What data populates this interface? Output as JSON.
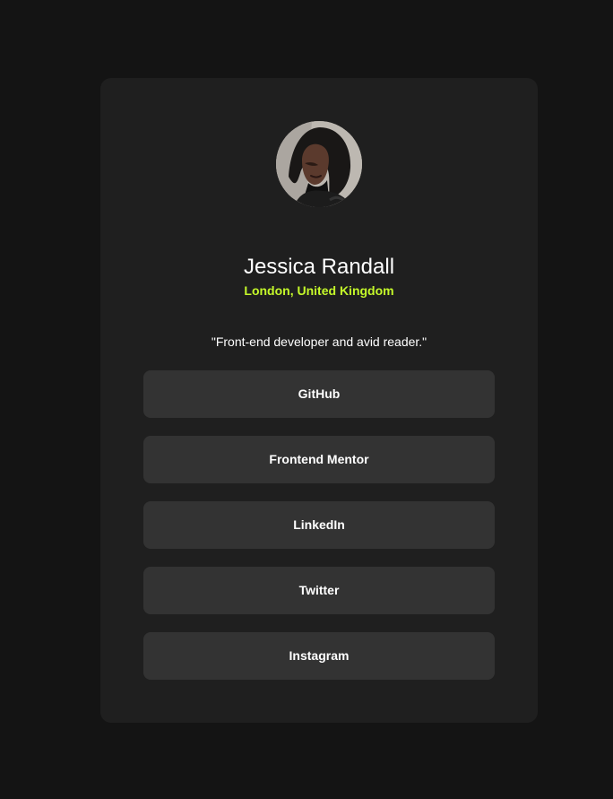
{
  "profile": {
    "name": "Jessica Randall",
    "location": "London, United Kingdom",
    "bio": "\"Front-end developer and avid reader.\"",
    "avatar_icon": "profile-photo"
  },
  "links": [
    {
      "label": "GitHub"
    },
    {
      "label": "Frontend Mentor"
    },
    {
      "label": "LinkedIn"
    },
    {
      "label": "Twitter"
    },
    {
      "label": "Instagram"
    }
  ],
  "colors": {
    "background": "#141414",
    "card": "#1f1f1f",
    "button": "#333333",
    "accent": "#c4f82a",
    "text": "#ffffff"
  }
}
